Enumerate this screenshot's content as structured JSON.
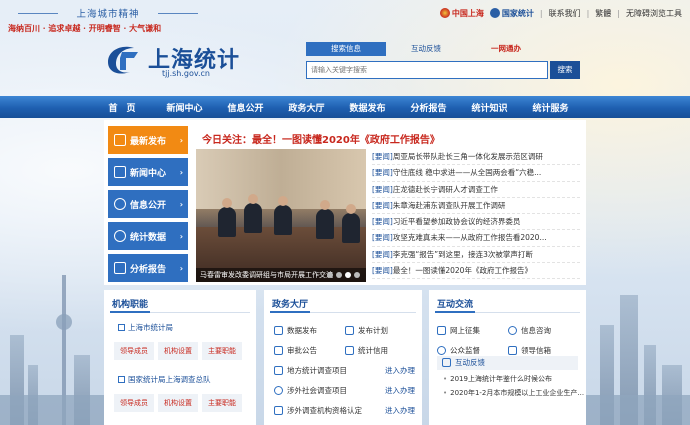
{
  "header": {
    "slogan_title": "上海城市精神",
    "slogan_sub": "海纳百川 · 追求卓越 · 开明睿智 · 大气谦和",
    "links": {
      "cn_shanghai": "中国上海",
      "national_stats": "国家统计",
      "contact": "联系我们",
      "traditional": "繁體",
      "accessibility": "无障碍浏览工具"
    },
    "site_name": "上海统计",
    "site_url": "tjj.sh.gov.cn"
  },
  "search": {
    "tabs": [
      "搜索信息",
      "互动反馈",
      "一网通办"
    ],
    "placeholder": "请输入关键字搜索",
    "button": "搜索"
  },
  "nav": [
    "首　页",
    "新闻中心",
    "信息公开",
    "政务大厅",
    "数据发布",
    "分析报告",
    "统计知识",
    "统计服务"
  ],
  "sidetabs": [
    "最新发布",
    "新闻中心",
    "信息公开",
    "统计数据",
    "分析报告"
  ],
  "headline": "今日关注：最全！一图读懂2020年《政府工作报告》",
  "photo_caption": "马春雷审发改委调研组与市局开展工作交流",
  "news": [
    {
      "tag": "[要闻]",
      "text": "周亚局长带队赴长三角一体化发展示范区调研"
    },
    {
      "tag": "[要闻]",
      "text": "守住底线 稳中求进——从全国两会看“六稳..."
    },
    {
      "tag": "[要闻]",
      "text": "庄龙德赴长宁调研人才调查工作"
    },
    {
      "tag": "[要闻]",
      "text": "朱章海赴浦东调查队开展工作调研"
    },
    {
      "tag": "[要闻]",
      "text": "习近平看望参加政协会议的经济界委员"
    },
    {
      "tag": "[要闻]",
      "text": "攻坚克难真未来——从政府工作报告看2020..."
    },
    {
      "tag": "[要闻]",
      "text": "李克强“报告”到这里，接连3次被掌声打断"
    },
    {
      "tag": "[要闻]",
      "text": "最全！一图读懂2020年《政府工作报告》"
    }
  ],
  "panel_org": {
    "title": "机构职能",
    "org1": "上海市统计局",
    "org1_buttons": [
      "领导成员",
      "机构设置",
      "主要职能"
    ],
    "org2": "国家统计局上海调查总队",
    "org2_buttons": [
      "领导成员",
      "机构设置",
      "主要职能"
    ]
  },
  "panel_gov": {
    "title": "政务大厅",
    "grid": [
      [
        "数据发布",
        "发布计划"
      ],
      [
        "审批公告",
        "统计信用"
      ]
    ],
    "services": [
      {
        "label": "地方统计调查项目",
        "go": "进入办理"
      },
      {
        "label": "涉外社会调查项目",
        "go": "进入办理"
      },
      {
        "label": "涉外调查机构资格认定",
        "go": "进入办理"
      }
    ]
  },
  "panel_interact": {
    "title": "互动交流",
    "grid": [
      [
        "网上征集",
        "信息咨询"
      ],
      [
        "公众监督",
        "领导信箱"
      ]
    ],
    "feedback_title": "互动反馈",
    "feedback": [
      "2019上海统计年鉴什么时候公布",
      "2020年1-2月本市规模以上工业企业生产..."
    ]
  }
}
